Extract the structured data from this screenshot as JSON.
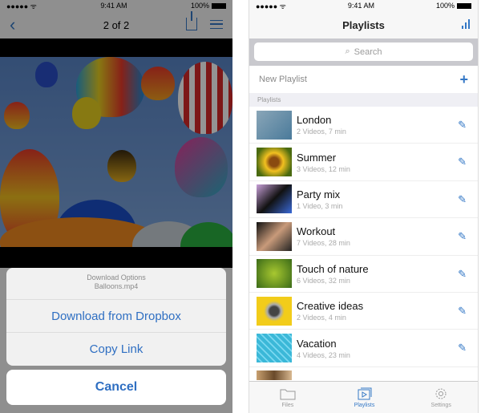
{
  "left": {
    "status": {
      "time": "9:41 AM",
      "battery": "100%",
      "signal": "●●●●● ᯤ"
    },
    "nav": {
      "title": "2 of 2",
      "back_icon": "chevron-left-icon",
      "share_icon": "share-icon",
      "list_icon": "list-icon"
    },
    "sheet": {
      "title": "Download Options",
      "subtitle": "Balloons.mp4",
      "actions": [
        "Download from Dropbox",
        "Copy Link"
      ],
      "cancel": "Cancel"
    },
    "accent": "#2f6fc2"
  },
  "right": {
    "status": {
      "time": "9:41 AM",
      "battery": "100%",
      "signal": "●●●●● ᯤ"
    },
    "nav": {
      "title": "Playlists",
      "sort_icon": "bars-icon"
    },
    "search": {
      "placeholder": "Search",
      "icon": "search-icon"
    },
    "new_playlist": {
      "label": "New Playlist",
      "icon": "plus-icon"
    },
    "section_label": "Playlists",
    "playlists": [
      {
        "title": "London",
        "meta": "2 Videos, 7 min",
        "thumb": "#6f8fa4"
      },
      {
        "title": "Summer",
        "meta": "3 Videos, 12 min",
        "thumb": "#d6b21c"
      },
      {
        "title": "Party mix",
        "meta": "1 Video, 3 min",
        "thumb": "#3c4a7a"
      },
      {
        "title": "Workout",
        "meta": "7 Videos, 28 min",
        "thumb": "#2a2a2a"
      },
      {
        "title": "Touch of nature",
        "meta": "6 Videos, 32 min",
        "thumb": "#5c8a2a"
      },
      {
        "title": "Creative ideas",
        "meta": "2 Videos, 4 min",
        "thumb": "#f2cc1a"
      },
      {
        "title": "Vacation",
        "meta": "4 Videos, 23 min",
        "thumb": "#3bb8d8"
      }
    ],
    "tabs": [
      {
        "label": "Files",
        "icon": "folder-icon",
        "active": false
      },
      {
        "label": "Playlists",
        "icon": "playlist-icon",
        "active": true
      },
      {
        "label": "Settings",
        "icon": "gear-icon",
        "active": false
      }
    ]
  }
}
